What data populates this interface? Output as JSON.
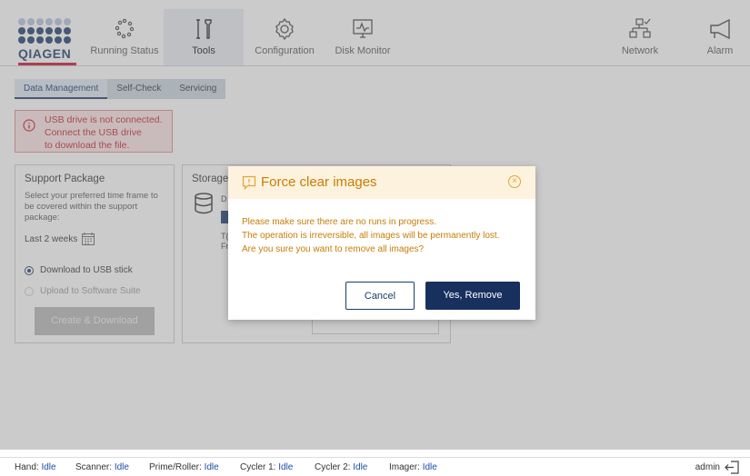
{
  "brand": {
    "name": "QIAGEN"
  },
  "nav": {
    "items": [
      {
        "label": "Running Status"
      },
      {
        "label": "Tools"
      },
      {
        "label": "Configuration"
      },
      {
        "label": "Disk Monitor"
      },
      {
        "label": "Network"
      },
      {
        "label": "Alarm"
      }
    ]
  },
  "subtabs": [
    "Data Management",
    "Self-Check",
    "Servicing"
  ],
  "warning": {
    "line1": "USB drive is not connected.",
    "line2": "Connect the USB drive",
    "line3": "to download the file."
  },
  "support": {
    "title": "Support Package",
    "desc_line1": "Select your preferred time frame to",
    "desc_line2": "be covered within the support",
    "desc_line3": "package:",
    "timeframe": "Last 2 weeks",
    "radio1": "Download to USB stick",
    "radio2": "Upload to Software Suite",
    "button": "Create & Download"
  },
  "storage": {
    "title": "Storage",
    "frag1": "D",
    "frag2": "T(",
    "frag3": "Fr"
  },
  "dialog": {
    "title": "Force clear images",
    "line1": "Please make sure there are no runs in progress.",
    "line2": "The operation is irreversible, all images will be permanently lost.",
    "line3": "Are you sure you want to remove all images?",
    "cancel": "Cancel",
    "confirm": "Yes, Remove"
  },
  "status": {
    "hand": {
      "label": "Hand:",
      "value": "Idle"
    },
    "scanner": {
      "label": "Scanner:",
      "value": "Idle"
    },
    "prime_roller": {
      "label": "Prime/Roller:",
      "value": "Idle"
    },
    "cycler1": {
      "label": "Cycler 1:",
      "value": "Idle"
    },
    "cycler2": {
      "label": "Cycler 2:",
      "value": "Idle"
    },
    "imager": {
      "label": "Imager:",
      "value": "Idle"
    },
    "user": "admin"
  },
  "colors": {
    "brand_blue": "#1b3a6b",
    "error_red": "#c61f2c",
    "warning_orange": "#c67d06",
    "status_blue": "#1b4fa3"
  }
}
